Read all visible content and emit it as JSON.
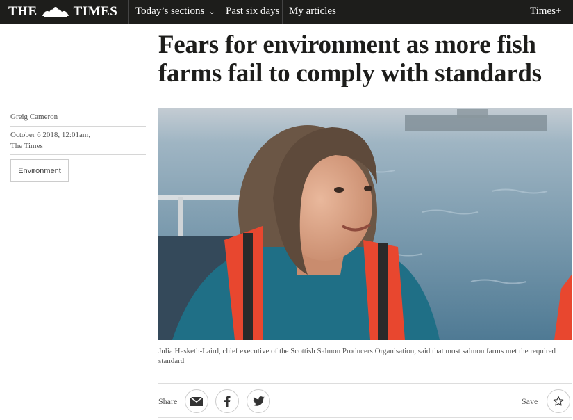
{
  "nav": {
    "logo_left": "THE",
    "logo_right": "TIMES",
    "sections_label": "Today’s sections",
    "past_label": "Past six days",
    "my_articles_label": "My articles",
    "times_plus_label": "Times+"
  },
  "article": {
    "headline": "Fears for environment as more fish farms fail to comply with standards",
    "author": "Greig Cameron",
    "date": "October 6 2018, 12:01am,",
    "publication": "The Times",
    "tag": "Environment",
    "caption": "Julia Hesketh-Laird, chief executive of the Scottish Salmon Producers Organisation, said that most salmon farms met the required standard"
  },
  "share": {
    "share_label": "Share",
    "save_label": "Save"
  },
  "icons": {
    "email": "email-icon",
    "facebook": "facebook-icon",
    "twitter": "twitter-icon",
    "star": "star-icon"
  },
  "colors": {
    "nav_bg": "#1d1d1b",
    "headline": "#1d1d1b",
    "sea": "#6f93a9",
    "lifejacket": "#e8472f",
    "jacket": "#1f6f86"
  }
}
